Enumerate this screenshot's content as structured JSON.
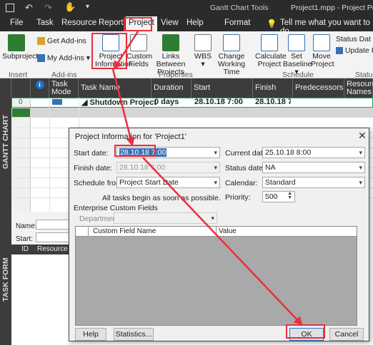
{
  "titlebar": {
    "tools_label": "Gantt Chart Tools",
    "file_title": "Project1.mpp - Project Profe"
  },
  "tabs": {
    "file": "File",
    "task": "Task",
    "resource": "Resource",
    "report": "Report",
    "project": "Project",
    "view": "View",
    "help": "Help",
    "format": "Format",
    "tellme": "Tell me what you want to do"
  },
  "ribbon": {
    "subproject": "Subproject",
    "get_addins": "Get Add-ins",
    "my_addins": "My Add-ins",
    "project_info": "Project Information",
    "custom_fields": "Custom Fields",
    "links": "Links Between Projects",
    "wbs": "WBS",
    "change_time": "Change Working Time",
    "calc": "Calculate Project",
    "set_baseline": "Set Baseline",
    "move": "Move Project",
    "status_date": "Status Dat",
    "update": "Update P",
    "g_insert": "Insert",
    "g_addins": "Add-ins",
    "g_props": "Properties",
    "g_schedule": "Schedule",
    "g_status": "Status"
  },
  "grid": {
    "h_task_mode": "Task Mode",
    "h_task_name": "Task Name",
    "h_duration": "Duration",
    "h_start": "Start",
    "h_finish": "Finish",
    "h_pred": "Predecessors",
    "h_res": "Resource Names",
    "row_id": "0",
    "task_name": "Shutdown Project",
    "duration": "0 days",
    "start": "28.10.18 7:00",
    "finish": "28.10.18 7:0"
  },
  "side": {
    "gantt": "GANTT CHART",
    "taskform": "TASK FORM"
  },
  "taskform": {
    "name": "Name:",
    "start": "Start:",
    "id": "ID",
    "resource_name": "Resource Na"
  },
  "dialog": {
    "title": "Project Information for 'Project1'",
    "start_label": "Start date:",
    "start_value": "28.10.18 7:00",
    "finish_label": "Finish date:",
    "finish_value": "28.10.18 7:00",
    "schedule_label": "Schedule from:",
    "schedule_value": "Project Start Date",
    "note": "All tasks begin as soon as possible.",
    "current_label": "Current date:",
    "current_value": "25.10.18 8:00",
    "status_label": "Status date:",
    "status_value": "NA",
    "calendar_label": "Calendar:",
    "calendar_value": "Standard",
    "priority_label": "Priority:",
    "priority_value": "500",
    "ecf_label": "Enterprise Custom Fields",
    "dept_label": "Department:",
    "col_field": "Custom Field Name",
    "col_value": "Value",
    "help": "Help",
    "stats": "Statistics...",
    "ok": "OK",
    "cancel": "Cancel"
  }
}
